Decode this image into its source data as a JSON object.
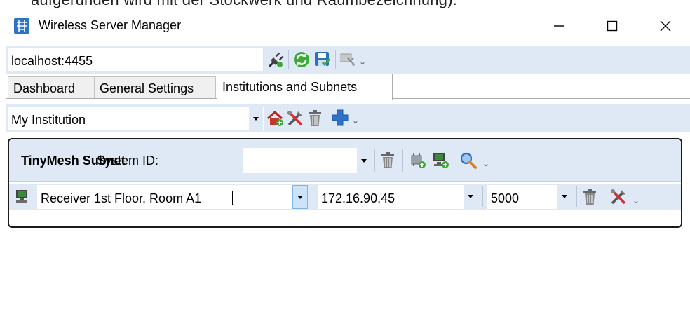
{
  "background_text": "aufgerunden wird mit der Stockwerk und Raumbezeichnung).",
  "window": {
    "title": "Wireless Server Manager",
    "controls": {
      "minimize": "—",
      "maximize": "☐",
      "close": "✕"
    }
  },
  "server": {
    "address": "localhost:4455",
    "icons": [
      "plug-icon",
      "refresh-icon",
      "save-icon",
      "settings-icon"
    ]
  },
  "tabs": [
    {
      "label": "Dashboard",
      "active": false
    },
    {
      "label": "General Settings",
      "active": false
    },
    {
      "label": "Institutions and Subnets",
      "active": true
    }
  ],
  "institution": {
    "selected": "My Institution",
    "icons": [
      "add-house-icon",
      "tools-icon",
      "trash-icon",
      "add-icon"
    ]
  },
  "subnet": {
    "title": "TinyMesh Subnet",
    "system_id_label": "System ID:",
    "system_id_value": "",
    "icons": [
      "trash-icon",
      "add-gateway-icon",
      "add-receiver-icon",
      "search-icon"
    ]
  },
  "receiver": {
    "name": "Receiver 1st Floor, Room A1",
    "ip": "172.16.90.45",
    "port": "5000",
    "icons": [
      "receiver-icon",
      "trash-icon",
      "tools-icon"
    ]
  },
  "overflow_glyph": "⌄",
  "colors": {
    "toolbar_bg": "#dfe9f5",
    "accent": "#2f73c9",
    "tab_border": "#acacac"
  }
}
